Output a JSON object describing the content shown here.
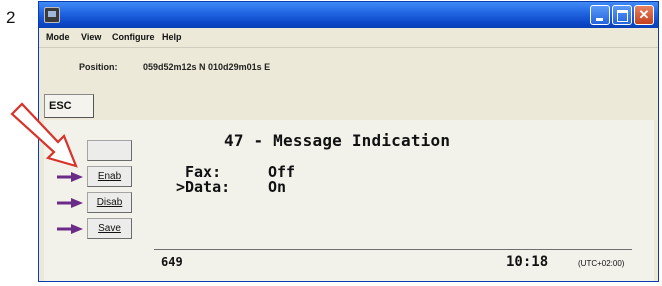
{
  "step_number": "2",
  "menu": [
    "Mode",
    "View",
    "Configure",
    "Help"
  ],
  "position": {
    "label": "Position:",
    "value": "059d52m12s N 010d29m01s E"
  },
  "esc_label": "ESC",
  "softkeys": [
    {
      "label": "",
      "has_arrow": false
    },
    {
      "label": "Enab",
      "has_arrow": true
    },
    {
      "label": "Disab",
      "has_arrow": true
    },
    {
      "label": "Save",
      "has_arrow": true
    }
  ],
  "screen": {
    "title": "47 - Message Indication",
    "selector": ">",
    "fields": [
      {
        "label": "Fax:",
        "value": "Off"
      },
      {
        "label": "Data:",
        "value": "On"
      }
    ],
    "footer_code": "649",
    "time": "10:18",
    "timezone": "(UTC+02:00)"
  },
  "icons": {
    "app": "terminal-app-icon",
    "minimize": "minimize-icon",
    "maximize": "maximize-icon",
    "close": "close-icon",
    "softkey_arrow": "purple-arrow-icon",
    "pointer": "red-outline-arrow-icon"
  },
  "colors": {
    "title_bar": "#1f62e0",
    "softkey_arrow": "#6a2c86",
    "pointer_arrow": "#d8332a",
    "window_bg": "#ece9d8"
  }
}
